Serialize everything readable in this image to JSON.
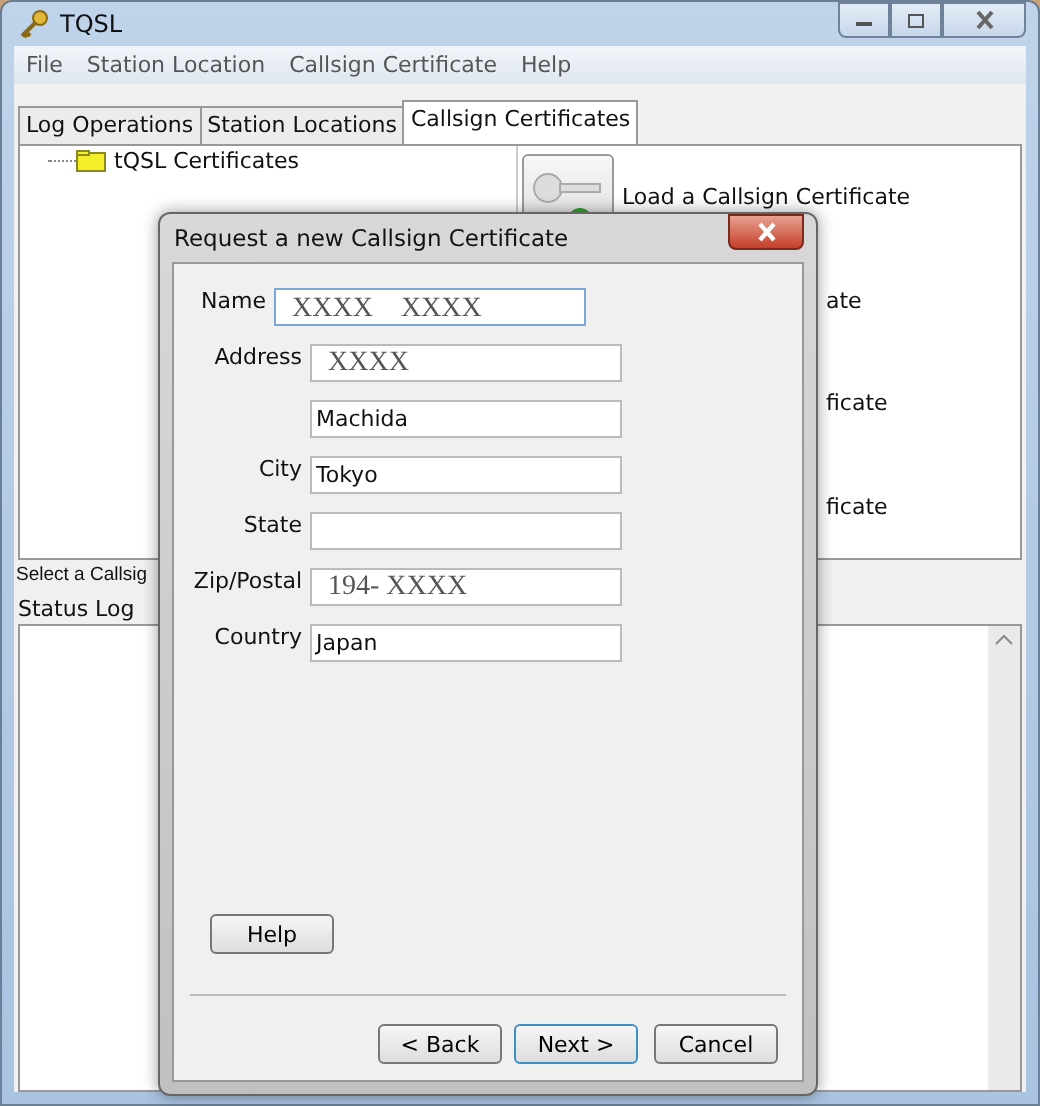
{
  "window": {
    "title": "TQSL"
  },
  "menu": [
    "File",
    "Station Location",
    "Callsign Certificate",
    "Help"
  ],
  "tabs": [
    {
      "label": "Log Operations",
      "selected": false
    },
    {
      "label": "Station Locations",
      "selected": false
    },
    {
      "label": "Callsign Certificates",
      "selected": true
    }
  ],
  "tree": [
    {
      "label": "tQSL Certificates"
    }
  ],
  "actions": [
    "Load a Callsign Certificate",
    "ate",
    "ficate",
    "ficate"
  ],
  "status_text": "Select a Callsig",
  "status_log": {
    "label": "Status Log"
  },
  "dialog": {
    "title": "Request a new Callsign Certificate",
    "fields": [
      {
        "label": "Name",
        "value": "XXXX　XXXX",
        "focused": true
      },
      {
        "label": "Address",
        "value": "XXXX",
        "focused": false
      },
      {
        "value": "Machida",
        "focused": false
      },
      {
        "label": "City",
        "value": "Tokyo",
        "focused": false
      },
      {
        "label": "State",
        "focused": false
      },
      {
        "label": "Zip/Postal",
        "value": "194- XXXX",
        "focused": false
      },
      {
        "label": "Country",
        "value": "Japan",
        "focused": false
      }
    ],
    "help_button": "Help",
    "buttons": [
      {
        "label": "< Back",
        "default": false
      },
      {
        "label": "Next >",
        "default": true
      },
      {
        "label": "Cancel",
        "default": false
      }
    ]
  }
}
